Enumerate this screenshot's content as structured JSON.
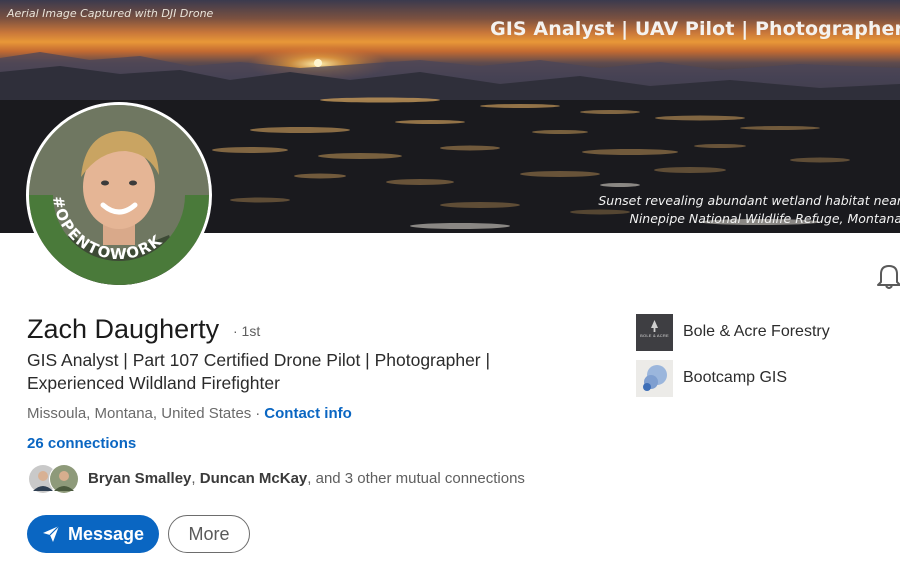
{
  "banner": {
    "caption_top_left": "Aerial Image Captured with DJI Drone",
    "title": "GIS Analyst | UAV Pilot | Photographer",
    "caption_line1": "Sunset revealing abundant wetland habitat near",
    "caption_line2": "Ninepipe National Wildlife Refuge, Montana"
  },
  "avatar": {
    "frame_text": "#OPENTOWORK",
    "frame_color": "#4a7a3a"
  },
  "profile": {
    "name": "Zach Daugherty",
    "degree": "· 1st",
    "headline": "GIS Analyst | Part 107 Certified Drone Pilot | Photographer | Experienced Wildland Firefighter",
    "location": "Missoula, Montana, United States",
    "separator": "·",
    "contact_info": "Contact info",
    "connections": "26 connections",
    "mutual": {
      "name1": "Bryan Smalley",
      "comma": ", ",
      "name2": "Duncan McKay",
      "rest": ", and 3 other mutual connections"
    }
  },
  "actions": {
    "message": "Message",
    "more": "More"
  },
  "experience": [
    {
      "name": "Bole & Acre Forestry",
      "logo_text": "BOLE & ACRE"
    },
    {
      "name": "Bootcamp GIS",
      "logo_text": ""
    }
  ],
  "colors": {
    "accent": "#0a66c2",
    "opentowork": "#4a7a3a"
  },
  "icons": {
    "bell": "bell-icon",
    "send": "paper-plane-icon"
  }
}
